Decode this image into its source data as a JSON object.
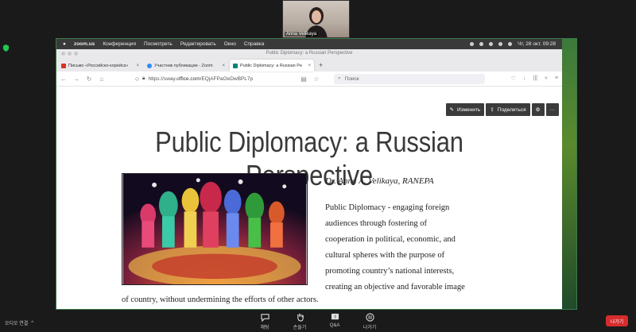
{
  "participant": {
    "name": "Anna Velikaya"
  },
  "menubar": {
    "app": "zoom.us",
    "items": [
      "Конференция",
      "Посмотреть",
      "Редактировать",
      "Окно",
      "Справка"
    ],
    "clock": "Чт, 28 окт.  09:28"
  },
  "browser": {
    "window_title": "Public Diplomacy: a Russian Perspective",
    "tabs": [
      {
        "label": "Письмо «Российско-корейск»",
        "color": "#d93025"
      },
      {
        "label": "Участник публикации - Zoom",
        "color": "#2d8cff"
      },
      {
        "label": "Public Diplomacy: a Russian Pe",
        "color": "#00857a"
      }
    ],
    "url_prefix": "https://sway.",
    "url_domain": "office.com",
    "url_rest": "/EQjAFPaOeDwBPL7p",
    "search_placeholder": "Поиск"
  },
  "sway": {
    "edit_label": "Изменить",
    "share_label": "Поделиться",
    "title": "Public Diplomacy: a Russian Perspective",
    "author": "Dr. Anna A. Velikaya, RANEPA",
    "paragraph": [
      "Public Diplomacy - engaging foreign",
      "audiences through fostering of",
      "cooperation in political, economic, and",
      "cultural spheres with the purpose of",
      "promoting country’s national interests,",
      "creating an objective and favorable image"
    ],
    "paragraph_tail": "of country, without undermining the efforts of other actors."
  },
  "zoom": {
    "audio_label": "오디오 연결",
    "buttons": [
      "채팅",
      "손들기",
      "Q&A",
      "나가기"
    ],
    "leave_label": "나가기"
  },
  "colors": {
    "leave": "#d62c2c",
    "sway_toolbar": "#3b3b3b"
  }
}
